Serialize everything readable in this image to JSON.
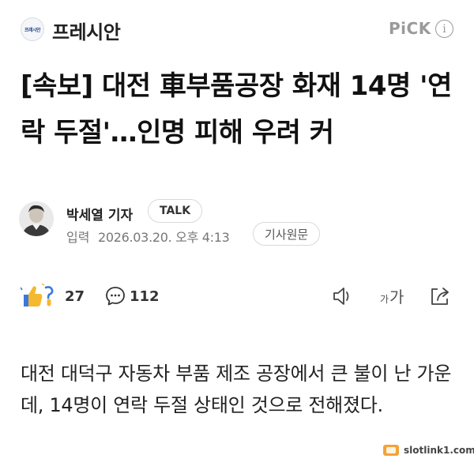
{
  "header": {
    "press_logo_text": "프레시안",
    "press_name": "프레시안",
    "pick_label": "PiCK",
    "info_icon": "i"
  },
  "article": {
    "title": "[속보] 대전 車부품공장 화재 14명 '연락 두절'…인명 피해 우려 커",
    "reporter": "박세열 기자",
    "talk_label": "TALK",
    "date_label": "입력",
    "date_value": "2026.03.20. 오후 4:13",
    "original_label": "기사원문",
    "body": "대전 대덕구 자동차 부품 제조 공장에서 큰 불이 난 가운데, 14명이 연락 두절 상태인 것으로 전해졌다."
  },
  "actions": {
    "reaction_count": "27",
    "comment_count": "112",
    "font_small": "가",
    "font_big": "가"
  },
  "watermark": {
    "text": "slotlink1.com"
  },
  "icons": {
    "reaction": "reaction-icon",
    "comment": "comment-icon",
    "audio": "audio-icon",
    "font_size": "font-size-icon",
    "share": "share-icon"
  },
  "colors": {
    "reaction_yellow": "#f5b82e",
    "reaction_blue": "#3a78e0",
    "muted_gray": "#9a9a9a"
  }
}
